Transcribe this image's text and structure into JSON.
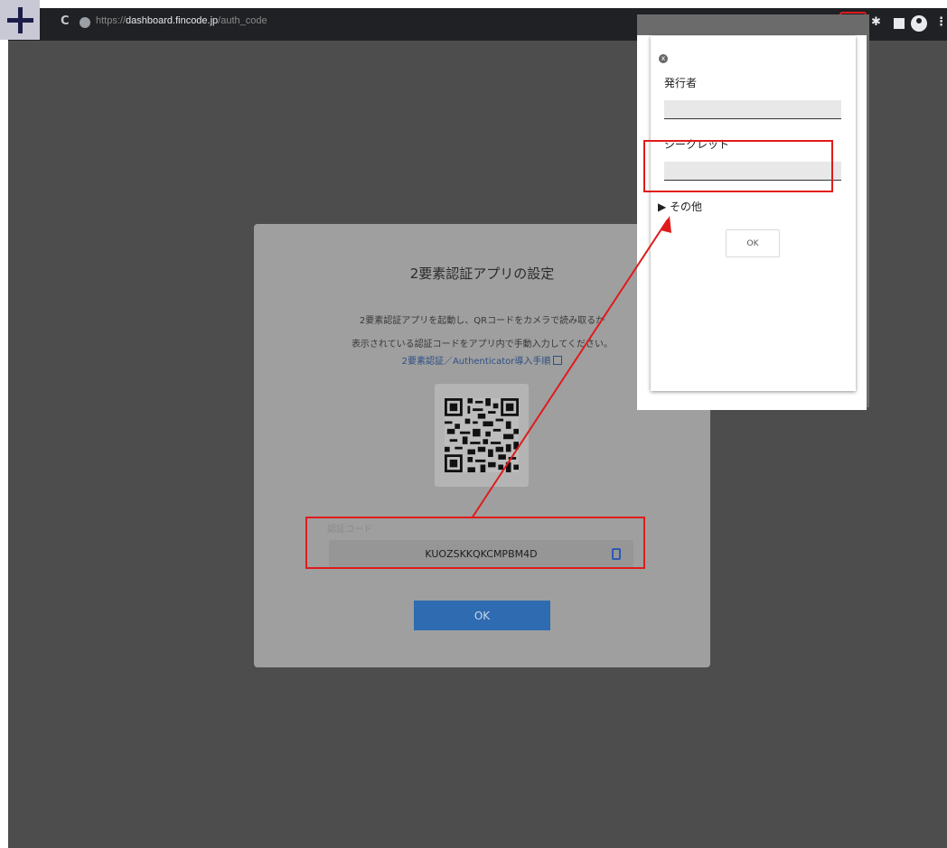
{
  "browser": {
    "url_scheme": "https://",
    "url_host": "dashboard.fincode.jp",
    "url_path": "/auth_code",
    "reload_icon": "reload-icon",
    "menu_glyph": "⋮"
  },
  "modal": {
    "title": "2要素認証アプリの設定",
    "instruction_line1": "2要素認証アプリを起動し、QRコードをカメラで読み取るか",
    "instruction_line2": "表示されている認証コードをアプリ内で手動入力してください。",
    "guide_link": "2要素認証／Authenticator導入手順",
    "auth_code_label": "認証コード",
    "auth_code_value": "KUOZSKKQKCMPBM4D",
    "ok_button": "OK"
  },
  "popup": {
    "close_glyph": "x",
    "issuer_label": "発行者",
    "issuer_value": "",
    "secret_label": "シークレット",
    "secret_value": "",
    "others_toggle": "▶ その他",
    "ok_button": "OK"
  },
  "annotation": {
    "highlight_color": "#e01b1b"
  }
}
